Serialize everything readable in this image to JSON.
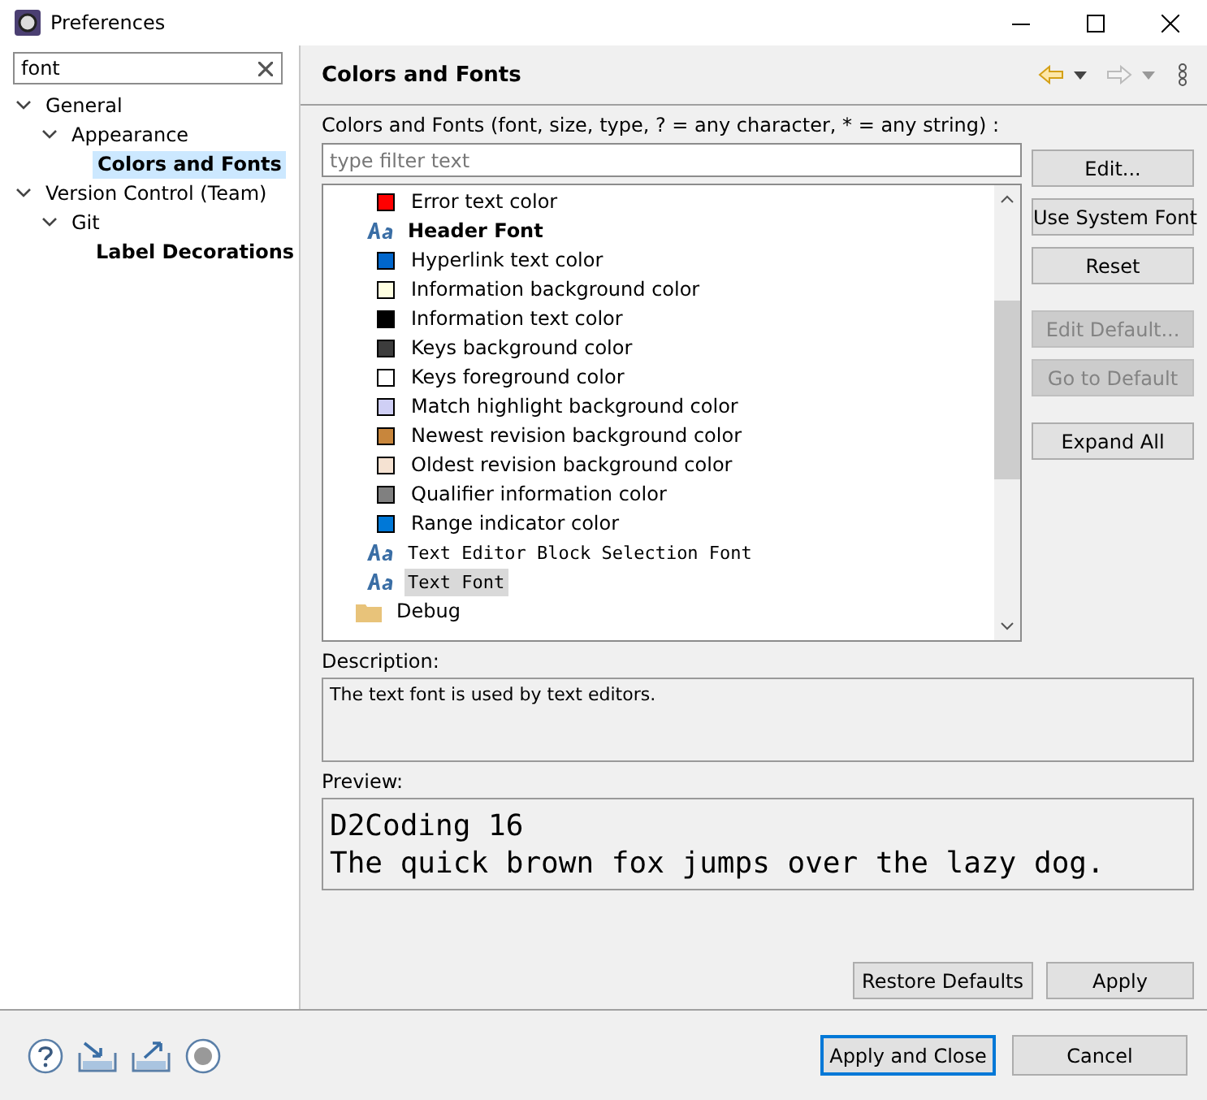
{
  "window": {
    "title": "Preferences"
  },
  "sidebar": {
    "filter": {
      "value": "font"
    },
    "tree": [
      {
        "label": "General",
        "expanded": true,
        "selected": false,
        "matched": false,
        "children": [
          {
            "label": "Appearance",
            "expanded": true,
            "selected": false,
            "matched": false,
            "children": [
              {
                "label": "Colors and Fonts",
                "selected": true,
                "matched": true
              }
            ]
          }
        ]
      },
      {
        "label": "Version Control (Team)",
        "expanded": true,
        "selected": false,
        "matched": false,
        "children": [
          {
            "label": "Git",
            "expanded": true,
            "selected": false,
            "matched": false,
            "children": [
              {
                "label": "Label Decorations",
                "selected": false,
                "matched": true
              }
            ]
          }
        ]
      }
    ]
  },
  "page": {
    "title": "Colors and Fonts",
    "filter_label": "Colors and Fonts (font, size, type, ? = any character, * = any string) :",
    "filter": {
      "placeholder": "type filter text"
    },
    "items": [
      {
        "kind": "color",
        "label": "Error text color",
        "color": "#ff0000",
        "selected": false
      },
      {
        "kind": "headerfont",
        "label": "Header Font",
        "selected": false
      },
      {
        "kind": "color",
        "label": "Hyperlink text color",
        "color": "#0066cc",
        "selected": false
      },
      {
        "kind": "color",
        "label": "Information background color",
        "color": "#ffffe1",
        "selected": false
      },
      {
        "kind": "color",
        "label": "Information text color",
        "color": "#000000",
        "selected": false
      },
      {
        "kind": "color",
        "label": "Keys background color",
        "color": "#3c3c3c",
        "selected": false
      },
      {
        "kind": "color",
        "label": "Keys foreground color",
        "color": "#ffffff",
        "selected": false
      },
      {
        "kind": "color",
        "label": "Match highlight background color",
        "color": "#cfcff5",
        "selected": false
      },
      {
        "kind": "color",
        "label": "Newest revision background color",
        "color": "#c8863c",
        "selected": false
      },
      {
        "kind": "color",
        "label": "Oldest revision background color",
        "color": "#f5e2d2",
        "selected": false
      },
      {
        "kind": "color",
        "label": "Qualifier information color",
        "color": "#808080",
        "selected": false
      },
      {
        "kind": "color",
        "label": "Range indicator color",
        "color": "#0078d7",
        "selected": false
      },
      {
        "kind": "monofont",
        "label": "Text Editor Block Selection Font",
        "selected": false
      },
      {
        "kind": "monofont",
        "label": "Text Font",
        "selected": true
      },
      {
        "kind": "folder",
        "label": "Debug",
        "selected": false
      }
    ],
    "side_buttons": [
      {
        "label": "Edit...",
        "disabled": false
      },
      {
        "label": "Use System Font",
        "disabled": false
      },
      {
        "label": "Reset",
        "disabled": false
      },
      {
        "label": "Edit Default...",
        "disabled": true
      },
      {
        "label": "Go to Default",
        "disabled": true
      },
      {
        "label": "Expand All",
        "disabled": false
      }
    ],
    "description": {
      "label": "Description:",
      "text": "The text font is used by text editors."
    },
    "preview": {
      "label": "Preview:",
      "lines": [
        "D2Coding 16",
        "The quick brown fox jumps over the lazy dog."
      ]
    },
    "buttons": [
      {
        "label": "Restore Defaults"
      },
      {
        "label": "Apply"
      }
    ]
  },
  "footer": {
    "buttons": [
      {
        "label": "Apply and Close",
        "default": true
      },
      {
        "label": "Cancel",
        "default": false
      }
    ]
  }
}
